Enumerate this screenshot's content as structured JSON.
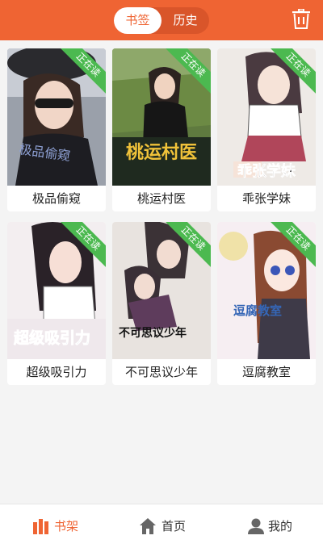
{
  "header": {
    "tabs": [
      {
        "label": "书签",
        "active": true
      },
      {
        "label": "历史",
        "active": false
      }
    ],
    "trash_icon": "trash-icon"
  },
  "badge_text": "正在读",
  "books": [
    {
      "title": "极品偷窥",
      "cover_text": "极品偷窥"
    },
    {
      "title": "桃运村医",
      "cover_text": "桃运村医"
    },
    {
      "title": "乖张学妹",
      "cover_text": "乖张学妹"
    },
    {
      "title": "超级吸引力",
      "cover_text": "超级吸引力"
    },
    {
      "title": "不可思议少年",
      "cover_text": "不可思议少年"
    },
    {
      "title": "逗腐教室",
      "cover_text": "逗腐教室"
    }
  ],
  "tabbar": [
    {
      "label": "书架",
      "icon": "bookshelf-icon",
      "active": true
    },
    {
      "label": "首页",
      "icon": "home-icon",
      "active": false
    },
    {
      "label": "我的",
      "icon": "user-icon",
      "active": false
    }
  ],
  "colors": {
    "accent": "#ef6433",
    "badge": "#4cb950",
    "inactive": "#333333"
  }
}
